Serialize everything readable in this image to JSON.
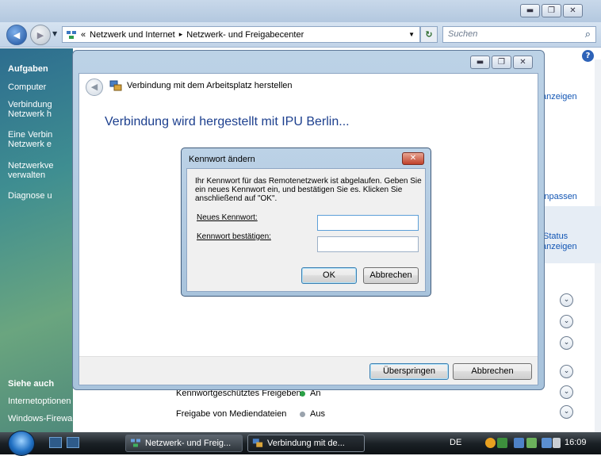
{
  "window": {
    "caption_buttons": [
      "minimize-icon",
      "maximize-icon",
      "close-icon"
    ]
  },
  "address": {
    "prefix": "«",
    "crumbs": [
      "Netzwerk und Internet",
      "Netzwerk- und Freigabecenter"
    ],
    "separator": "▸",
    "search_placeholder": "Suchen"
  },
  "taskpane": {
    "header": "Aufgaben",
    "items": [
      "Computer",
      "Verbindung",
      "Netzwerk h",
      "Eine Verbin",
      "Netzwerk e",
      "Netzwerkve",
      "verwalten",
      "Diagnose u"
    ],
    "see_also_header": "Siehe auch",
    "see_also": [
      "Internetoptionen",
      "Windows-Firewall"
    ]
  },
  "rightpane": {
    "links": [
      "anzeigen",
      "Anpassen",
      "Status",
      "anzeigen"
    ],
    "settings": [
      {
        "label": "Kennwortgeschütztes Freigeben",
        "value": "An",
        "on": true
      },
      {
        "label": "Freigabe von Mediendateien",
        "value": "Aus",
        "on": false
      }
    ]
  },
  "wizard": {
    "title": "Verbindung mit dem Arbeitsplatz herstellen",
    "heading": "Verbindung wird hergestellt mit IPU Berlin...",
    "skip_label": "Überspringen",
    "cancel_label": "Abbrechen"
  },
  "pwdialog": {
    "title": "Kennwort ändern",
    "message": "Ihr Kennwort für das Remotenetzwerk ist abgelaufen. Geben Sie ein neues Kennwort ein, und bestätigen Sie es. Klicken Sie anschließend auf \"OK\".",
    "new_label": "Neues Kennwort:",
    "confirm_label": "Kennwort bestätigen:",
    "ok_label": "OK",
    "cancel_label": "Abbrechen",
    "new_value": "",
    "confirm_value": ""
  },
  "taskbar": {
    "tasks": [
      "Netzwerk- und Freig...",
      "Verbindung mit de..."
    ],
    "language": "DE",
    "clock": "16:09"
  },
  "colors": {
    "link": "#1155b4",
    "heading": "#1c3f8e",
    "pane_green": "#6aa57f"
  }
}
